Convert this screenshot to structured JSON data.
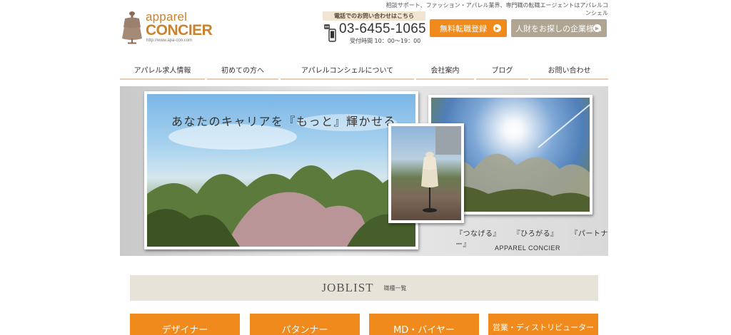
{
  "header": {
    "tagline": "相談サポート、ファッション・アパレル業界、専門職の転職エージェントはアパレルコンシェル",
    "logo": {
      "line1": "apparel",
      "line2": "CONCIER",
      "url": "http://www.apa-con.com"
    },
    "phone": {
      "label": "電話でのお問い合わせはこちら",
      "number": "03-6455-1065",
      "hours": "受付時間 10：00〜19：00"
    },
    "buttons": {
      "register": "無料転職登録",
      "corporate": "人財をお探しの企業様へ"
    }
  },
  "nav": {
    "items": [
      {
        "label": "アパレル求人情報"
      },
      {
        "label": "初めての方へ"
      },
      {
        "label": "アパレルコンシェルについて"
      },
      {
        "label": "会社案内"
      },
      {
        "label": "ブログ"
      },
      {
        "label": "お問い合わせ"
      }
    ]
  },
  "hero": {
    "title": "あなたのキャリアを『もっと』輝かせる",
    "tags": "『つなげる』 『ひろがる』 『パートナー』",
    "brand": "APPAREL CONCIER"
  },
  "joblist": {
    "heading": "JOBLIST",
    "sub": "職種一覧",
    "tiles": [
      "デザイナー",
      "パタンナー",
      "MD・バイヤー",
      "営業・ディストリビューター"
    ]
  },
  "colors": {
    "accent": "#f08a1c",
    "secondary": "#b0a592",
    "brand": "#c9822e"
  }
}
